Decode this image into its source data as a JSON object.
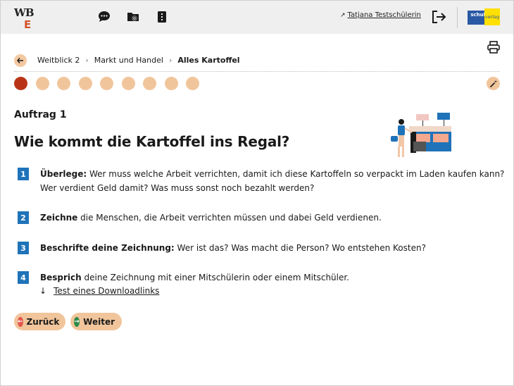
{
  "header": {
    "logo_top": "WB",
    "logo_letter": "E",
    "icons": [
      "chat-icon",
      "folder-settings-icon",
      "notebook-icon"
    ],
    "user_name": "Tatjana Testschülerin",
    "publisher_left": "schul",
    "publisher_right": "verlag"
  },
  "breadcrumb": {
    "items": [
      "Weitblick 2",
      "Markt und Handel",
      "Alles Kartoffel"
    ]
  },
  "steps": {
    "total": 9,
    "active_index": 0
  },
  "content": {
    "label": "Auftrag 1",
    "title": "Wie kommt die Kartoffel ins Regal?"
  },
  "tasks": [
    {
      "number": "1",
      "bold": "Überlege:",
      "text": " Wer muss welche Arbeit verrichten, damit ich diese Kartoffeln so verpackt im Laden kaufen kann? Wer verdient Geld damit? Was muss sonst noch bezahlt werden?"
    },
    {
      "number": "2",
      "bold": "Zeichne",
      "text": " die Menschen, die Arbeit verrichten müssen und dabei Geld verdienen."
    },
    {
      "number": "3",
      "bold": "Beschrifte deine Zeichnung:",
      "text": " Wer ist das? Was macht die Person? Wo entstehen Kosten?"
    },
    {
      "number": "4",
      "bold": "Besprich",
      "text": " deine Zeichnung mit einer Mitschülerin oder einem Mitschüler."
    }
  ],
  "download_link": "Test eines Downloadlinks",
  "buttons": {
    "back": "Zurück",
    "next": "Weiter"
  },
  "colors": {
    "accent": "#f1c59b",
    "active_step": "#b93416",
    "task_number": "#1f73b9",
    "back_icon": "#e4574a",
    "next_icon": "#2b8a4a"
  }
}
